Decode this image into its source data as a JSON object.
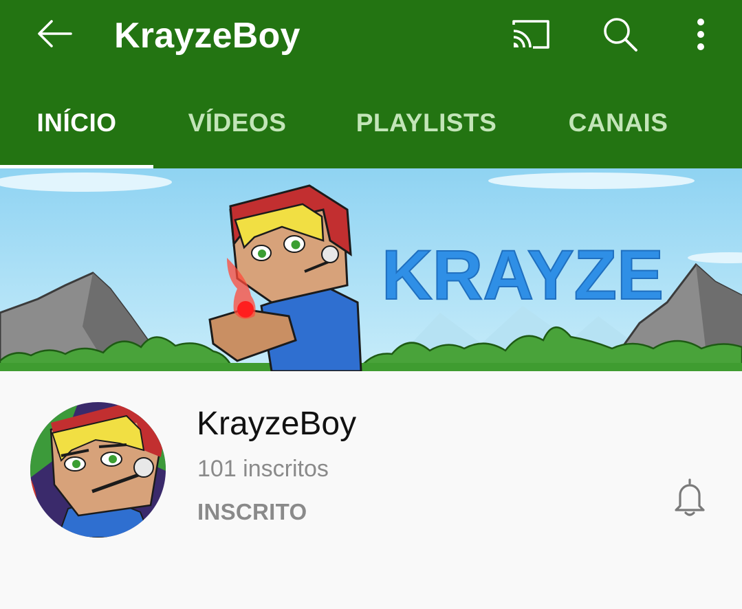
{
  "app_bar": {
    "title": "KrayzeBoy",
    "color": "#237412",
    "icons": [
      "arrow-left-icon",
      "cast-icon",
      "search-icon",
      "more-vert-icon"
    ]
  },
  "tabs": [
    {
      "label": "INÍCIO",
      "active": true
    },
    {
      "label": "VÍDEOS",
      "active": false
    },
    {
      "label": "PLAYLISTS",
      "active": false
    },
    {
      "label": "CANAIS",
      "active": false
    }
  ],
  "banner": {
    "text": "KRAYZE"
  },
  "channel": {
    "name": "KrayzeBoy",
    "subscribers": "101 inscritos",
    "subscribe_status": "INSCRITO",
    "notification_icon": "bell-icon"
  }
}
